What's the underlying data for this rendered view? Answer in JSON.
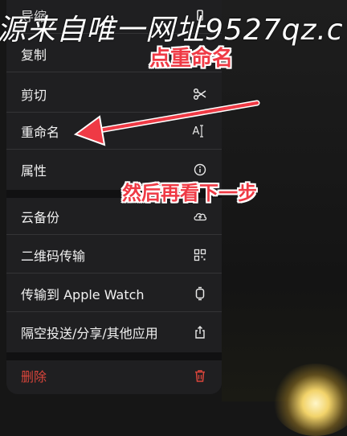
{
  "menu": {
    "items": [
      {
        "label": "导缩",
        "icon": "unknown-icon"
      },
      {
        "label": "复制",
        "icon": ""
      },
      {
        "label": "剪切",
        "icon": "scissors-icon"
      },
      {
        "label": "重命名",
        "icon": "text-cursor-icon",
        "icon_text": "A"
      },
      {
        "label": "属性",
        "icon": "info-circle-icon"
      },
      {
        "label": "云备份",
        "icon": "cloud-upload-icon"
      },
      {
        "label": "二维码传输",
        "icon": "qr-code-icon"
      },
      {
        "label": "传输到 Apple Watch",
        "icon": "watch-icon"
      },
      {
        "label": "隔空投送/分享/其他应用",
        "icon": "share-icon"
      },
      {
        "label": "删除",
        "icon": "trash-icon",
        "color": "#d9453b"
      }
    ]
  },
  "overlay": {
    "watermark": "源来自唯一网址9527qz.c",
    "annotation_rename": "点重命名",
    "annotation_next": "然后再看下一步",
    "annotation_color": "#ef3a45"
  }
}
